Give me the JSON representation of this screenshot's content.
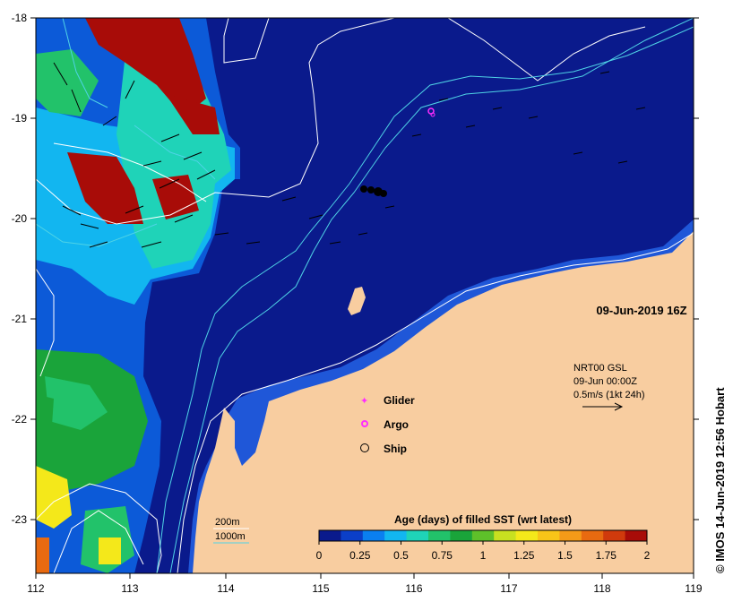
{
  "map": {
    "x_ticks": [
      "112",
      "113",
      "114",
      "115",
      "116",
      "117",
      "118",
      "119"
    ],
    "y_ticks": [
      "-18",
      "-19",
      "-20",
      "-21",
      "-22",
      "-23"
    ],
    "date_label": "09-Jun-2019 16Z",
    "credit": "© IMOS 14-Jun-2019 12:56 Hobart",
    "colors": {
      "ocean": "#0a1a8c",
      "land": "#f8cda0",
      "coast_band": "#1f57d8",
      "isobath_200": "#ffffff",
      "isobath_1000": "#4fd3e6"
    }
  },
  "current_info": {
    "line1": "NRT00 GSL",
    "line2": "09-Jun 00:00Z",
    "line3": "0.5m/s (1kt 24h)"
  },
  "legend": {
    "glider": "Glider",
    "argo": "Argo",
    "ship": "Ship",
    "isobath_200": "200m",
    "isobath_1000": "1000m"
  },
  "colorbar": {
    "title": "Age (days) of filled SST (wrt latest)",
    "labels": [
      "0",
      "0.25",
      "0.5",
      "0.75",
      "1",
      "1.25",
      "1.5",
      "1.75",
      "2"
    ],
    "colors": [
      "#0a1a8c",
      "#0b3fc8",
      "#0a7ff0",
      "#12b6f0",
      "#1fd3b8",
      "#22c26a",
      "#1aa43a",
      "#5ec02a",
      "#c8e020",
      "#f4e81a",
      "#f8c418",
      "#f49a18",
      "#e86a10",
      "#d03a0c",
      "#a80c08"
    ]
  }
}
